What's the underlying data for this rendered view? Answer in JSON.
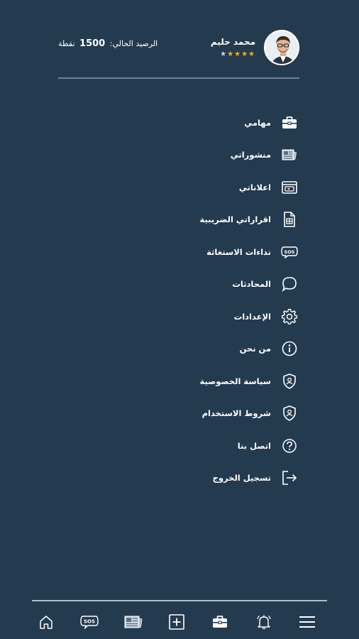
{
  "user": {
    "name": "محمد حليم",
    "rating": 4,
    "stars": [
      "★",
      "★",
      "★",
      "★",
      "★"
    ]
  },
  "balance": {
    "label": "الرصيد الحالي:",
    "value": "1500",
    "unit": "نقطة"
  },
  "menu": {
    "items": [
      {
        "label": "مهامي",
        "icon": "briefcase-icon"
      },
      {
        "label": "منشوراتي",
        "icon": "newspaper-icon"
      },
      {
        "label": "اعلاناتي",
        "icon": "ads-icon"
      },
      {
        "label": "اقراراتي الضريبية",
        "icon": "tax-document-icon"
      },
      {
        "label": "نداءات الاستغاثة",
        "icon": "sos-icon"
      },
      {
        "label": "المحادثات",
        "icon": "chat-bubble-icon"
      },
      {
        "label": "الإعدادات",
        "icon": "gear-icon"
      },
      {
        "label": "من نحن",
        "icon": "info-icon"
      },
      {
        "label": "سياسة الخصوصية",
        "icon": "shield-user-icon"
      },
      {
        "label": "شروط الاستخدام",
        "icon": "shield-user-icon"
      },
      {
        "label": "اتصل بنا",
        "icon": "help-icon"
      },
      {
        "label": "تسجيل الخروج",
        "icon": "logout-icon"
      }
    ]
  },
  "bottom_nav": {
    "items": [
      {
        "icon": "home-icon"
      },
      {
        "icon": "sos-icon"
      },
      {
        "icon": "newspaper-icon"
      },
      {
        "icon": "add-icon"
      },
      {
        "icon": "briefcase-icon"
      },
      {
        "icon": "bell-icon"
      },
      {
        "icon": "hamburger-menu-icon"
      }
    ]
  },
  "colors": {
    "background": "#243a4f",
    "star": "#f5b301",
    "text": "#ffffff"
  }
}
